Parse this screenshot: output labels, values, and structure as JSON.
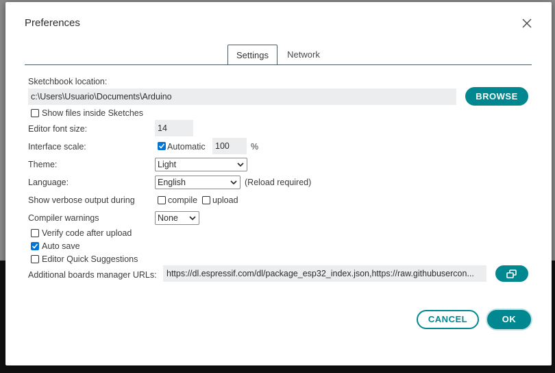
{
  "dialog": {
    "title": "Preferences",
    "tabs": [
      {
        "label": "Settings",
        "active": true
      },
      {
        "label": "Network",
        "active": false
      }
    ]
  },
  "sketchbook": {
    "label": "Sketchbook location:",
    "path": "c:\\Users\\Usuario\\Documents\\Arduino",
    "browse_label": "BROWSE",
    "show_files_label": "Show files inside Sketches",
    "show_files_checked": false
  },
  "editor_font": {
    "label": "Editor font size:",
    "value": "14"
  },
  "interface_scale": {
    "label": "Interface scale:",
    "automatic_label": "Automatic",
    "automatic_checked": true,
    "value": "100",
    "unit": "%"
  },
  "theme": {
    "label": "Theme:",
    "selected": "Light"
  },
  "language": {
    "label": "Language:",
    "selected": "English",
    "note": "(Reload required)"
  },
  "verbose": {
    "label": "Show verbose output during",
    "compile_label": "compile",
    "compile_checked": false,
    "upload_label": "upload",
    "upload_checked": false
  },
  "compiler_warnings": {
    "label": "Compiler warnings",
    "selected": "None"
  },
  "options": [
    {
      "label": "Verify code after upload",
      "checked": false
    },
    {
      "label": "Auto save",
      "checked": true
    },
    {
      "label": "Editor Quick Suggestions",
      "checked": false
    }
  ],
  "boards_manager": {
    "label": "Additional boards manager URLs:",
    "value": "https://dl.espressif.com/dl/package_esp32_index.json,https://raw.githubusercon..."
  },
  "actions": {
    "cancel_label": "CANCEL",
    "ok_label": "OK"
  },
  "colors": {
    "accent": "#00878f",
    "checkbox": "#0075d6"
  }
}
